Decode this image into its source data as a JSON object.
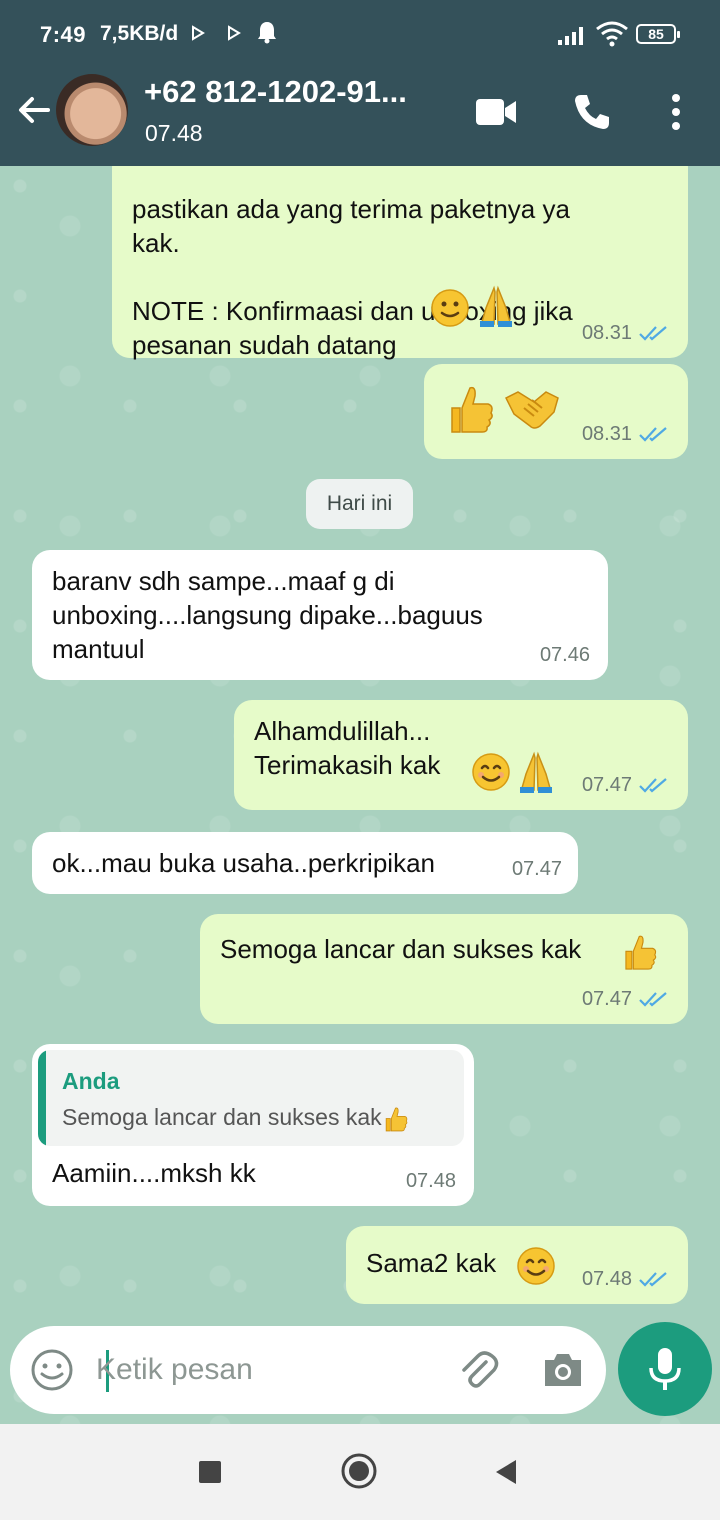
{
  "status_bar": {
    "time": "7:49",
    "network_speed": "7,5KB/d",
    "battery": "85"
  },
  "header": {
    "contact_name": "+62 812-1202-91...",
    "last_seen": "07.48"
  },
  "chat": {
    "date_separator": "Hari ini",
    "messages": [
      {
        "dir": "out",
        "text": "pastikan ada yang terima paketnya ya\nkak.\n\nNOTE : Konfirmaasi dan unboxing jika\npesanan sudah datang",
        "time": "08.31"
      },
      {
        "dir": "out",
        "text": "",
        "time": "08.31"
      },
      {
        "dir": "in",
        "text": "baranv sdh sampe...maaf g di\nunboxing....langsung dipake...baguus\nmantuul",
        "time": "07.46"
      },
      {
        "dir": "out",
        "text": "Alhamdulillah...\nTerimakasih kak",
        "time": "07.47"
      },
      {
        "dir": "in",
        "text": "ok...mau buka usaha..perkripikan",
        "time": "07.47"
      },
      {
        "dir": "out",
        "text": "Semoga lancar dan sukses kak",
        "time": "07.47"
      },
      {
        "dir": "in",
        "text": "Aamiin....mksh kk",
        "time": "07.48",
        "quote_author": "Anda",
        "quote_text": "Semoga lancar dan sukses kak"
      },
      {
        "dir": "out",
        "text": "Sama2 kak",
        "time": "07.48"
      }
    ]
  },
  "composer": {
    "placeholder": "Ketik pesan"
  },
  "colors": {
    "header_bg": "#34515a",
    "accent": "#1c9c7e",
    "outgoing_bubble": "#e6fbc9",
    "incoming_bubble": "#ffffff",
    "read_ticks": "#4fa9e4"
  },
  "icons": [
    "back-arrow-icon",
    "video-call-icon",
    "voice-call-icon",
    "more-menu-icon",
    "emoji-icon",
    "attach-icon",
    "camera-icon",
    "mic-icon",
    "nav-recents-icon",
    "nav-home-icon",
    "nav-back-icon"
  ]
}
